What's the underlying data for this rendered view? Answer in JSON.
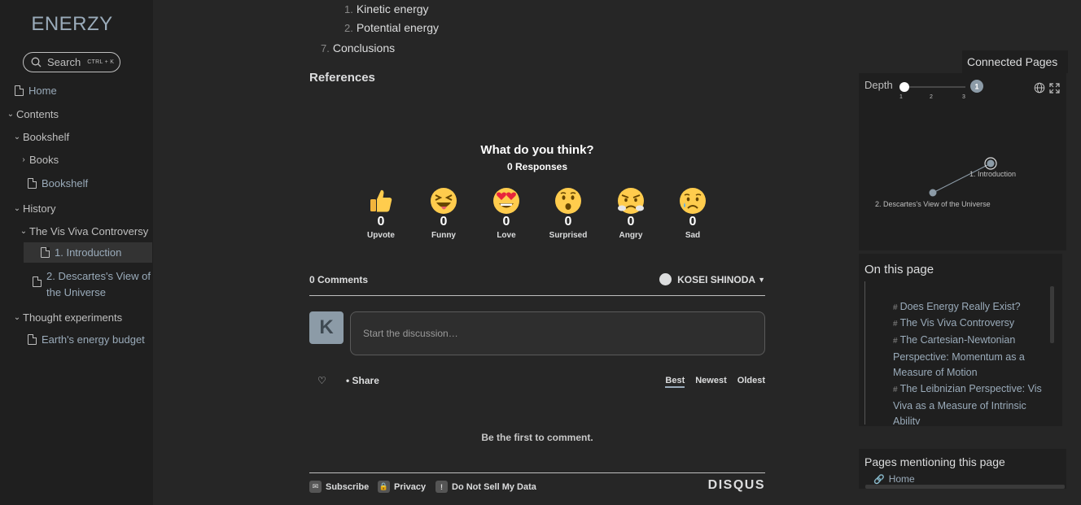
{
  "brand": "ENERZY",
  "search": {
    "label": "Search",
    "shortcut": "CTRL + K"
  },
  "nav": {
    "home": "Home",
    "contents": "Contents",
    "bookshelf_folder": "Bookshelf",
    "books": "Books",
    "bookshelf_page": "Bookshelf",
    "history": "History",
    "vis_viva": "The Vis Viva Controversy",
    "intro": "1. Introduction",
    "descartes_line1": "2. Descartes's View of",
    "descartes_line2": "the Universe",
    "thought": "Thought experiments",
    "earth": "Earth's energy budget"
  },
  "toc": [
    {
      "num": "1.",
      "label": "Kinetic energy"
    },
    {
      "num": "2.",
      "label": "Potential energy"
    },
    {
      "num": "7.",
      "label": "Conclusions"
    }
  ],
  "references": "References",
  "reactions": {
    "title": "What do you think?",
    "responses": "0 Responses",
    "items": [
      {
        "count": "0",
        "label": "Upvote"
      },
      {
        "count": "0",
        "label": "Funny"
      },
      {
        "count": "0",
        "label": "Love"
      },
      {
        "count": "0",
        "label": "Surprised"
      },
      {
        "count": "0",
        "label": "Angry"
      },
      {
        "count": "0",
        "label": "Sad"
      }
    ]
  },
  "comments": {
    "count": "0 Comments",
    "user": "KOSEI SHINODA",
    "avatar": "K",
    "placeholder": "Start the discussion…",
    "share": "Share",
    "sort": [
      "Best",
      "Newest",
      "Oldest"
    ],
    "empty": "Be the first to comment.",
    "footer": {
      "subscribe": "Subscribe",
      "privacy": "Privacy",
      "dnsmd": "Do Not Sell My Data",
      "brand": "DISQUS"
    }
  },
  "connected": {
    "title": "Connected Pages",
    "depth_label": "Depth",
    "depth_value": "1",
    "ticks": [
      "1",
      "2",
      "3"
    ],
    "nodes": [
      "1. Introduction",
      "2. Descartes's View of the Universe"
    ]
  },
  "on_this_page": {
    "title": "On this page",
    "items": [
      "Does Energy Really Exist?",
      "The Vis Viva Controversy",
      "The Cartesian-Newtonian Perspective: Momentum as a Measure of Motion",
      "The Leibnizian Perspective: Vis Viva as a Measure of Intrinsic Ability"
    ]
  },
  "mentions": {
    "title": "Pages mentioning this page",
    "items": [
      "Home"
    ]
  },
  "colors": {
    "accent": "#9aabba",
    "sidebar_bg": "#1f1f1f",
    "main_bg": "#262626"
  }
}
